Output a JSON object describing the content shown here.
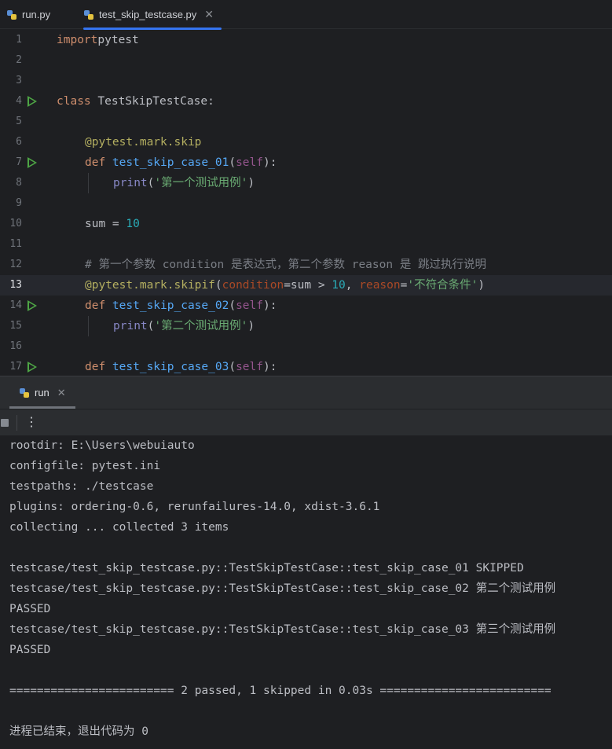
{
  "tabs": [
    {
      "label": "run.py",
      "active": false
    },
    {
      "label": "test_skip_testcase.py",
      "active": true
    }
  ],
  "editor": {
    "current_line": 13,
    "lines": [
      {
        "n": "1",
        "t": [
          [
            "kw",
            "import"
          ],
          [
            "",
            "pytest"
          ]
        ],
        "indent": 0
      },
      {
        "n": "2",
        "t": [],
        "indent": 0
      },
      {
        "n": "3",
        "t": [],
        "indent": 0
      },
      {
        "n": "4",
        "t": [
          [
            "kw",
            "class "
          ],
          [
            "",
            "TestSkipTestCase:"
          ]
        ],
        "indent": 0,
        "run": true
      },
      {
        "n": "5",
        "t": [],
        "indent": 0
      },
      {
        "n": "6",
        "t": [
          [
            "dec",
            "@pytest.mark.skip"
          ]
        ],
        "indent": 1
      },
      {
        "n": "7",
        "t": [
          [
            "kw",
            "def "
          ],
          [
            "fn",
            "test_skip_case_01"
          ],
          [
            "",
            "("
          ],
          [
            "self",
            "self"
          ],
          [
            "",
            "):"
          ]
        ],
        "indent": 1,
        "run": true
      },
      {
        "n": "8",
        "t": [
          [
            "builtin",
            "print"
          ],
          [
            "",
            "("
          ],
          [
            "str",
            "'第一个测试用例'"
          ],
          [
            "",
            ")"
          ]
        ],
        "indent": 2,
        "guide": true
      },
      {
        "n": "9",
        "t": [],
        "indent": 0
      },
      {
        "n": "10",
        "t": [
          [
            "",
            "sum = "
          ],
          [
            "num",
            "10"
          ]
        ],
        "indent": 1
      },
      {
        "n": "11",
        "t": [],
        "indent": 0
      },
      {
        "n": "12",
        "t": [
          [
            "cmt",
            "# 第一个参数 condition 是表达式，第二个参数 reason 是 跳过执行说明"
          ]
        ],
        "indent": 1
      },
      {
        "n": "13",
        "t": [
          [
            "dec",
            "@pytest.mark.skipif"
          ],
          [
            "",
            "("
          ],
          [
            "param",
            "condition"
          ],
          [
            "",
            "=sum > "
          ],
          [
            "num",
            "10"
          ],
          [
            "",
            ", "
          ],
          [
            "param",
            "reason"
          ],
          [
            "",
            "="
          ],
          [
            "str",
            "'不符合条件'"
          ],
          [
            "",
            ")"
          ]
        ],
        "indent": 1
      },
      {
        "n": "14",
        "t": [
          [
            "kw",
            "def "
          ],
          [
            "fn",
            "test_skip_case_02"
          ],
          [
            "",
            "("
          ],
          [
            "self",
            "self"
          ],
          [
            "",
            "):"
          ]
        ],
        "indent": 1,
        "run": true
      },
      {
        "n": "15",
        "t": [
          [
            "builtin",
            "print"
          ],
          [
            "",
            "("
          ],
          [
            "str",
            "'第二个测试用例'"
          ],
          [
            "",
            ")"
          ]
        ],
        "indent": 2,
        "guide": true
      },
      {
        "n": "16",
        "t": [],
        "indent": 0
      },
      {
        "n": "17",
        "t": [
          [
            "kw",
            "def "
          ],
          [
            "fn",
            "test_skip_case_03"
          ],
          [
            "",
            "("
          ],
          [
            "self",
            "self"
          ],
          [
            "",
            "):"
          ]
        ],
        "indent": 1,
        "run": true
      }
    ]
  },
  "tool_window": {
    "tab_label": "run"
  },
  "console": {
    "lines": [
      "rootdir: E:\\Users\\webuiauto",
      "configfile: pytest.ini",
      "testpaths: ./testcase",
      "plugins: ordering-0.6, rerunfailures-14.0, xdist-3.6.1",
      "collecting ... collected 3 items",
      "",
      "testcase/test_skip_testcase.py::TestSkipTestCase::test_skip_case_01 SKIPPED",
      "testcase/test_skip_testcase.py::TestSkipTestCase::test_skip_case_02 第二个测试用例",
      "PASSED",
      "testcase/test_skip_testcase.py::TestSkipTestCase::test_skip_case_03 第三个测试用例",
      "PASSED",
      "",
      "======================== 2 passed, 1 skipped in 0.03s =========================",
      "",
      "进程已结束，退出代码为 0"
    ]
  },
  "colors": {
    "accent": "#3574f0",
    "run_icon": "#4ea545"
  }
}
